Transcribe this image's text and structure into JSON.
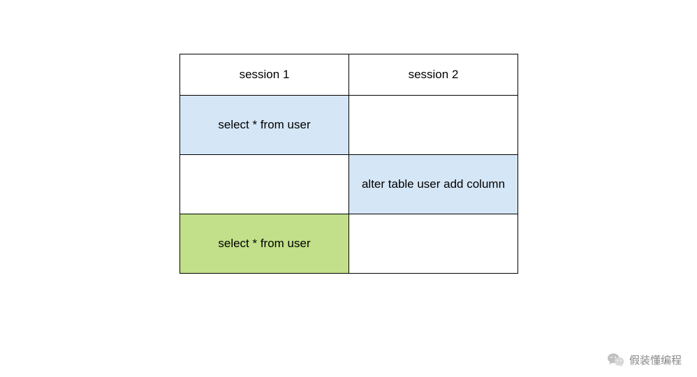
{
  "table": {
    "headers": [
      "session 1",
      "session 2"
    ],
    "rows": [
      {
        "cells": [
          {
            "text": "select * from user",
            "bg": "blue"
          },
          {
            "text": "",
            "bg": "none"
          }
        ]
      },
      {
        "cells": [
          {
            "text": "",
            "bg": "none"
          },
          {
            "text": "alter table user add column",
            "bg": "blue"
          }
        ]
      },
      {
        "cells": [
          {
            "text": "select * from user",
            "bg": "green"
          },
          {
            "text": "",
            "bg": "none"
          }
        ]
      }
    ]
  },
  "watermark": {
    "text": "假装懂编程"
  },
  "colors": {
    "blue": "#d5e6f6",
    "green": "#c1e089",
    "border": "#000000"
  }
}
